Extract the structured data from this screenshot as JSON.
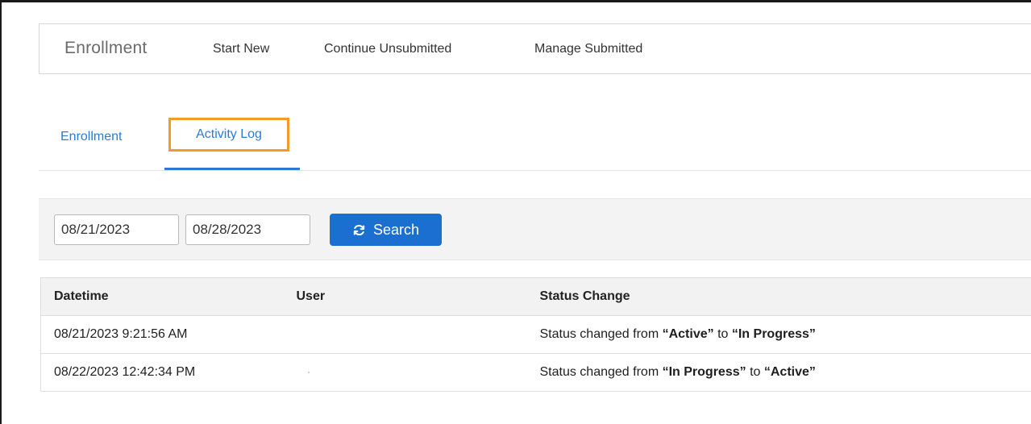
{
  "navbar": {
    "brand": "Enrollment",
    "links": [
      "Start New",
      "Continue Unsubmitted",
      "Manage Submitted"
    ]
  },
  "tabs": {
    "enrollment": "Enrollment",
    "activity_log": "Activity Log",
    "active": "Activity Log"
  },
  "filters": {
    "date_from": "08/21/2023",
    "date_to": "08/28/2023",
    "search_label": "Search",
    "search_icon": "refresh-icon"
  },
  "table": {
    "columns": [
      "Datetime",
      "User",
      "Status Change"
    ],
    "rows": [
      {
        "datetime": "08/21/2023 9:21:56 AM",
        "user": "",
        "status_prefix": "Status changed from ",
        "from_status": "“Active”",
        "to_word": " to ",
        "to_status": "“In Progress”"
      },
      {
        "datetime": "08/22/2023 12:42:34 PM",
        "user": "",
        "status_prefix": "Status changed from ",
        "from_status": "“In Progress”",
        "to_word": " to ",
        "to_status": "“Active”"
      }
    ]
  },
  "colors": {
    "link_blue": "#2b7bd6",
    "button_blue": "#1a6fd0",
    "highlight_orange": "#f39a2a"
  }
}
